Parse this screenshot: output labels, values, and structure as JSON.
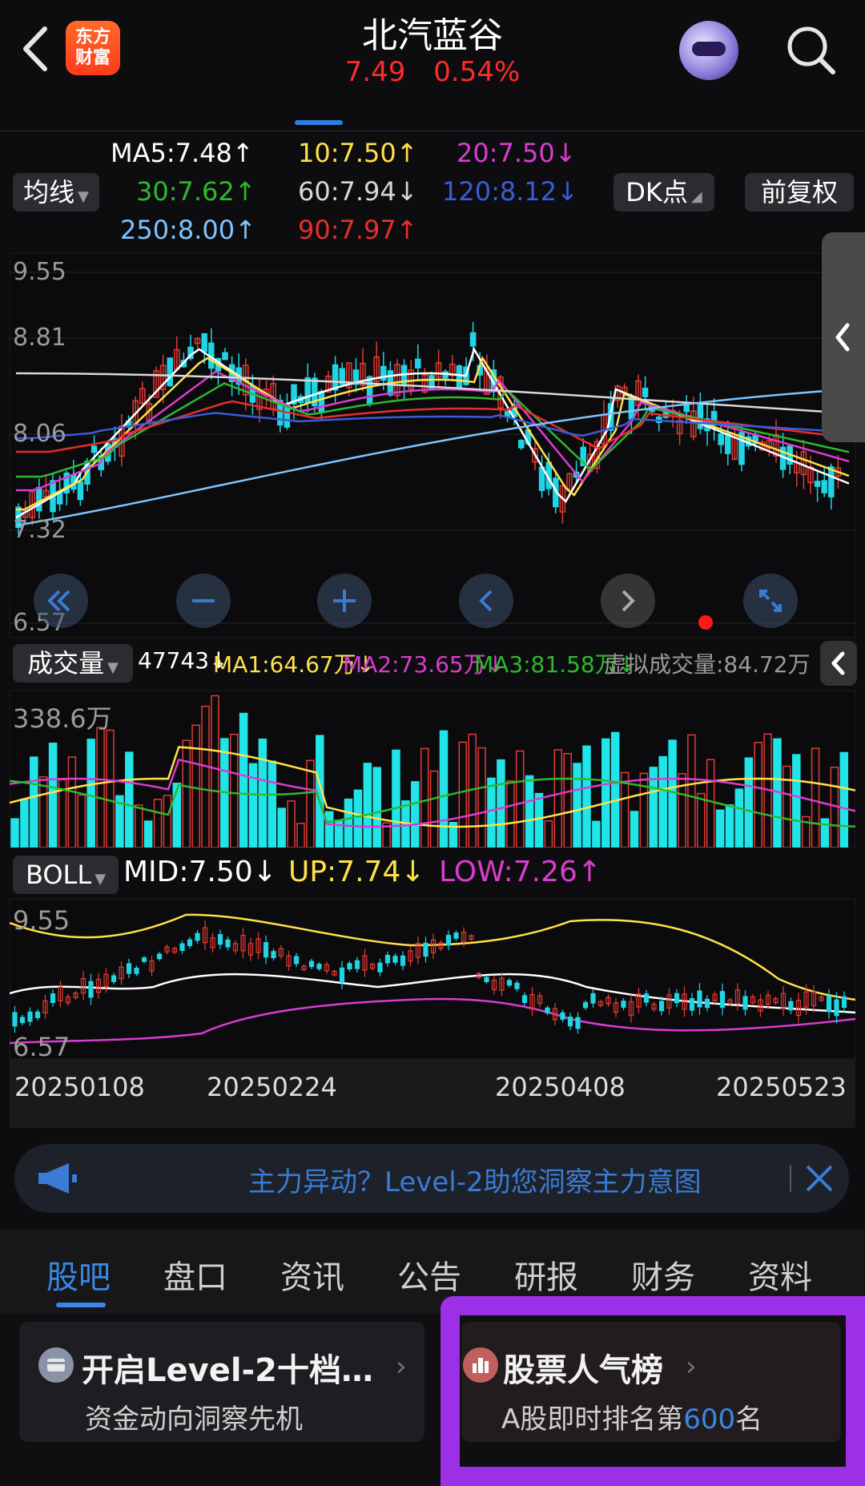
{
  "header": {
    "logo_line1": "东方",
    "logo_line2": "财富",
    "title": "北汽蓝谷",
    "price": "7.49",
    "change_pct": "0.54%",
    "price_color": "#ff2b2b"
  },
  "ma_panel": {
    "selector_label": "均线",
    "dk_button": "DK点",
    "adjust_button": "前复权",
    "items": [
      {
        "text": "MA5:7.48↑",
        "color": "#ffffff"
      },
      {
        "text": "10:7.50↑",
        "color": "#ffe14a"
      },
      {
        "text": "20:7.50↓",
        "color": "#d93dcf"
      },
      {
        "text": "30:7.62↑",
        "color": "#2eb82e"
      },
      {
        "text": "60:7.94↓",
        "color": "#d8d8d8"
      },
      {
        "text": "120:8.12↓",
        "color": "#3b5bd9"
      },
      {
        "text": "250:8.00↑",
        "color": "#7ec4ff"
      },
      {
        "text": "90:7.97↑",
        "color": "#e62e2e"
      }
    ],
    "price_ticks": [
      "9.55",
      "8.81",
      "8.06",
      "7.32",
      "6.57"
    ]
  },
  "volume_panel": {
    "selector_label": "成交量",
    "current": "47743↓",
    "ma1": "MA1:64.67万↓",
    "ma2": "MA2:73.65万↓",
    "ma3": "MA3:81.58万↓",
    "virtual": "虚拟成交量:84.72万",
    "max_tick": "338.6万"
  },
  "boll_panel": {
    "selector_label": "BOLL",
    "mid": "MID:7.50↓",
    "up": "UP:7.74↓",
    "low": "LOW:7.26↑",
    "ticks": [
      "9.55",
      "6.57"
    ]
  },
  "dates": [
    "20250108",
    "20250224",
    "20250408",
    "20250523"
  ],
  "banner": {
    "text": "主力异动？Level-2助您洞察主力意图",
    "accent": "#3a7bd5"
  },
  "tabs": [
    "股吧",
    "盘口",
    "资讯",
    "公告",
    "研报",
    "财务",
    "资料"
  ],
  "cards": [
    {
      "title": "开启Level-2十档…",
      "subtitle": "资金动向洞察先机"
    },
    {
      "title": "股票人气榜",
      "subtitle_prefix": "A股即时排名第",
      "rank": "600",
      "subtitle_suffix": "名"
    }
  ]
}
